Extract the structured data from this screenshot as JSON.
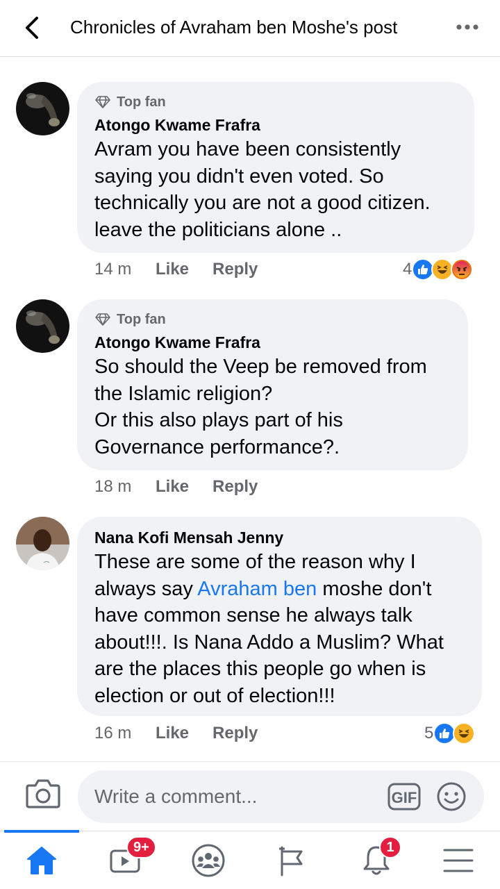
{
  "header": {
    "title": "Chronicles of Avraham ben Moshe's post"
  },
  "comments": [
    {
      "badge": "Top fan",
      "author": "Atongo Kwame Frafra",
      "text": "Avram you have been consistently saying you didn't even voted. So technically you are not a good citizen. leave the politicians alone ..",
      "time": "14 m",
      "like": "Like",
      "reply": "Reply",
      "reaction_count": "4",
      "reactions": [
        "like",
        "haha",
        "angry"
      ]
    },
    {
      "badge": "Top fan",
      "author": "Atongo Kwame Frafra",
      "text": "So should the Veep be removed from\nthe Islamic religion?\nOr this also plays part of his\nGovernance performance?.",
      "time": "18 m",
      "like": "Like",
      "reply": "Reply"
    },
    {
      "author": "Nana Kofi Mensah Jenny",
      "text_before": "These are some of the reason why I\nalways say ",
      "mention": "Avraham ben",
      "text_after": " moshe don't\nhave common sense he always talk\nabout!!!. Is Nana Addo a Muslim? What\nare the places this people go when is\nelection or out of election!!!",
      "time": "16 m",
      "like": "Like",
      "reply": "Reply",
      "reaction_count": "5",
      "reactions": [
        "like",
        "haha"
      ]
    }
  ],
  "composer": {
    "placeholder": "Write a comment...",
    "gif_label": "GIF"
  },
  "tabbar": {
    "watch_badge": "9+",
    "notifications_badge": "1"
  },
  "colors": {
    "accent": "#1877f2",
    "bubble": "#f0f2f5",
    "secondary_text": "#65676b",
    "badge": "#e41e3f"
  }
}
